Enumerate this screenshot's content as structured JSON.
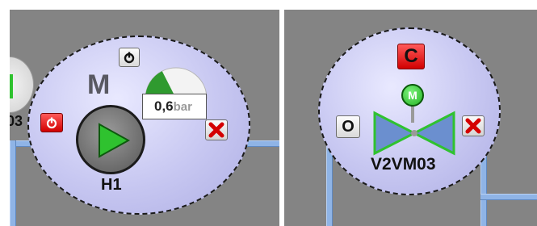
{
  "left_panel": {
    "partial_tag": "03",
    "motor_letter": "M",
    "pump_tag": "H1",
    "pressure": {
      "value": "0,6",
      "unit": "bar",
      "level": 0.35
    }
  },
  "right_panel": {
    "command_close": "C",
    "command_open": "O",
    "actuator_letter": "M",
    "valve_tag": "V2VM03"
  },
  "colors": {
    "background": "#848484",
    "faceplate": "#c7c7f1",
    "pipe": "#8fb4e6",
    "alarm_red": "#e00000",
    "run_green": "#2fc22f"
  },
  "icons": [
    "power-icon",
    "close-x-icon",
    "play-icon",
    "gauge-icon",
    "valve-icon"
  ]
}
